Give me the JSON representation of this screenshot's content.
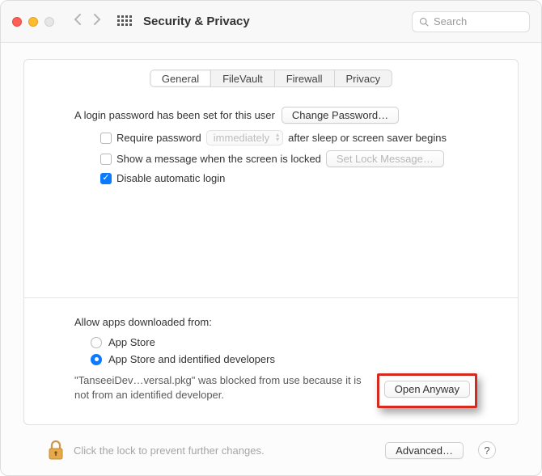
{
  "window": {
    "title": "Security & Privacy"
  },
  "search": {
    "placeholder": "Search"
  },
  "tabs": [
    {
      "label": "General",
      "active": true
    },
    {
      "label": "FileVault",
      "active": false
    },
    {
      "label": "Firewall",
      "active": false
    },
    {
      "label": "Privacy",
      "active": false
    }
  ],
  "login_password": {
    "text": "A login password has been set for this user",
    "change_button": "Change Password…"
  },
  "require_password": {
    "checked": false,
    "label_pre": "Require password",
    "delay": "immediately",
    "label_post": "after sleep or screen saver begins"
  },
  "show_message": {
    "checked": false,
    "label": "Show a message when the screen is locked",
    "button": "Set Lock Message…"
  },
  "disable_auto_login": {
    "checked": true,
    "label": "Disable automatic login"
  },
  "allow_apps": {
    "header": "Allow apps downloaded from:",
    "options": [
      {
        "label": "App Store",
        "selected": false
      },
      {
        "label": "App Store and identified developers",
        "selected": true
      }
    ]
  },
  "blocked": {
    "text": "\"TanseeiDev…versal.pkg\" was blocked from use because it is not from an identified developer.",
    "button": "Open Anyway"
  },
  "footer": {
    "lock_text": "Click the lock to prevent further changes.",
    "advanced": "Advanced…",
    "help": "?"
  }
}
